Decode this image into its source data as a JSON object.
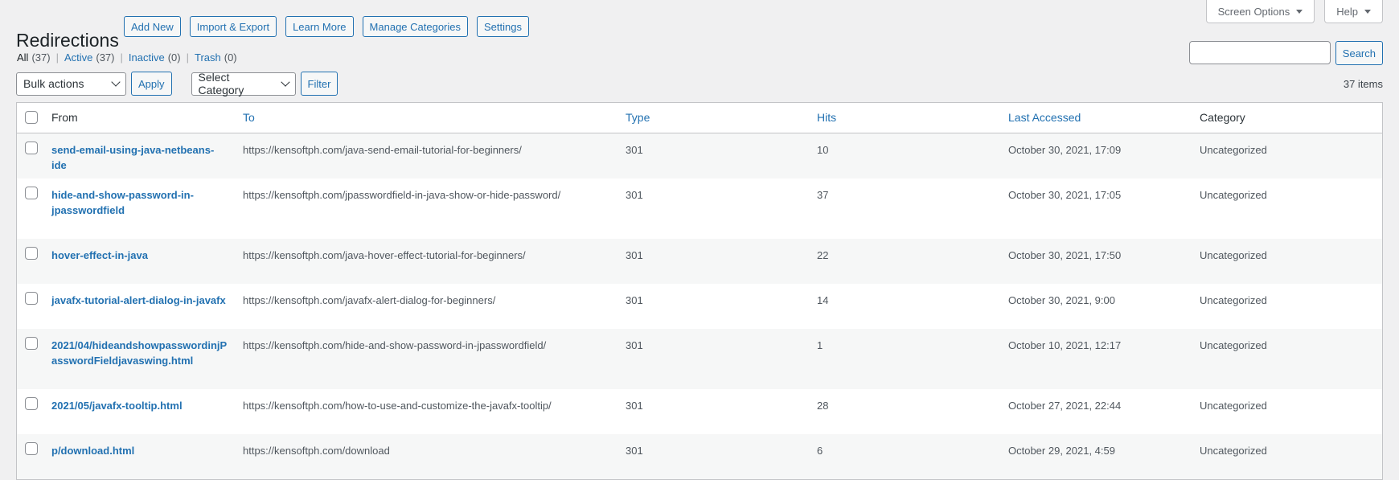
{
  "page": {
    "title": "Redirections",
    "actions": [
      "Add New",
      "Import & Export",
      "Learn More",
      "Manage Categories",
      "Settings"
    ]
  },
  "topbar": {
    "screen_options": "Screen Options",
    "help": "Help"
  },
  "filters": {
    "views": [
      {
        "label": "All",
        "count": "(37)",
        "current": true
      },
      {
        "label": "Active",
        "count": "(37)",
        "current": false
      },
      {
        "label": "Inactive",
        "count": "(0)",
        "current": false
      },
      {
        "label": "Trash",
        "count": "(0)",
        "current": false
      }
    ],
    "bulk_actions": "Bulk actions",
    "apply": "Apply",
    "category": "Select Category",
    "filter": "Filter"
  },
  "search": {
    "value": "",
    "button": "Search"
  },
  "items_count": "37 items",
  "table": {
    "columns": {
      "from": "From",
      "to": "To",
      "type": "Type",
      "hits": "Hits",
      "last_accessed": "Last Accessed",
      "category": "Category"
    },
    "rows": [
      {
        "from": "send-email-using-java-netbeans-ide",
        "to": "https://kensoftph.com/java-send-email-tutorial-for-beginners/",
        "type": "301",
        "hits": "10",
        "last": "October 30, 2021, 17:09",
        "category": "Uncategorized"
      },
      {
        "from": "hide-and-show-password-in-jpasswordfield",
        "to": "https://kensoftph.com/jpasswordfield-in-java-show-or-hide-password/",
        "type": "301",
        "hits": "37",
        "last": "October 30, 2021, 17:05",
        "category": "Uncategorized"
      },
      {
        "from": "hover-effect-in-java",
        "to": "https://kensoftph.com/java-hover-effect-tutorial-for-beginners/",
        "type": "301",
        "hits": "22",
        "last": "October 30, 2021, 17:50",
        "category": "Uncategorized"
      },
      {
        "from": "javafx-tutorial-alert-dialog-in-javafx",
        "to": "https://kensoftph.com/javafx-alert-dialog-for-beginners/",
        "type": "301",
        "hits": "14",
        "last": "October 30, 2021, 9:00",
        "category": "Uncategorized"
      },
      {
        "from": "2021/04/hideandshowpasswordinjPasswordFieldjavaswing.html",
        "to": "https://kensoftph.com/hide-and-show-password-in-jpasswordfield/",
        "type": "301",
        "hits": "1",
        "last": "October 10, 2021, 12:17",
        "category": "Uncategorized"
      },
      {
        "from": "2021/05/javafx-tooltip.html",
        "to": "https://kensoftph.com/how-to-use-and-customize-the-javafx-tooltip/",
        "type": "301",
        "hits": "28",
        "last": "October 27, 2021, 22:44",
        "category": "Uncategorized"
      },
      {
        "from": "p/download.html",
        "to": "https://kensoftph.com/download",
        "type": "301",
        "hits": "6",
        "last": "October 29, 2021, 4:59",
        "category": "Uncategorized"
      }
    ]
  }
}
